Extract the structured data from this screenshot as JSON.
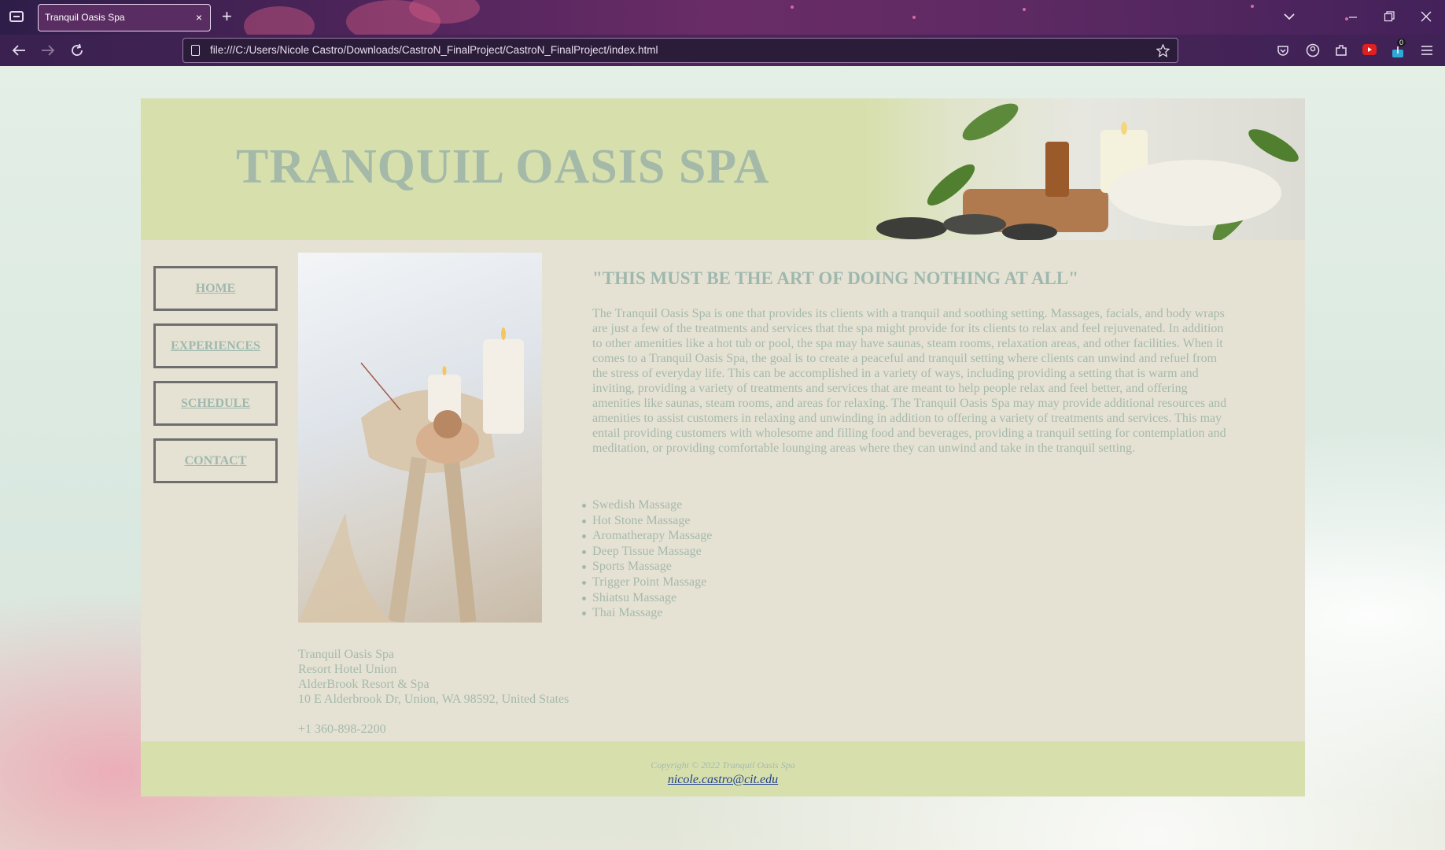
{
  "browser": {
    "tab_title": "Tranquil Oasis Spa",
    "tab_close": "×",
    "new_tab": "+",
    "url": "file:///C:/Users/Nicole Castro/Downloads/CastroN_FinalProject/CastroN_FinalProject/index.html",
    "downloads_badge": "0",
    "icons": {
      "tab_list": "tab-list-icon",
      "back": "back-arrow-icon",
      "forward": "forward-arrow-icon",
      "reload": "reload-icon",
      "bookmark": "star-icon",
      "pocket": "pocket-icon",
      "account": "account-icon",
      "extensions": "extensions-icon",
      "youtube": "youtube-icon",
      "download": "download-icon",
      "menu": "hamburger-menu-icon"
    }
  },
  "site": {
    "title": "TRANQUIL OASIS SPA",
    "nav": [
      "HOME",
      "EXPERIENCES",
      "SCHEDULE",
      "CONTACT"
    ],
    "quote": "\"THIS MUST BE THE ART OF DOING NOTHING AT ALL\"",
    "paragraph": "The Tranquil Oasis Spa is one that provides its clients with a tranquil and soothing setting. Massages, facials, and body wraps are just a few of the treatments and services that the spa might provide for its clients to relax and feel rejuvenated. In addition to other amenities like a hot tub or pool, the spa may have saunas, steam rooms, relaxation areas, and other facilities. When it comes to a Tranquil Oasis Spa, the goal is to create a peaceful and tranquil setting where clients can unwind and refuel from the stress of everyday life. This can be accomplished in a variety of ways, including providing a setting that is warm and inviting, providing a variety of treatments and services that are meant to help people relax and feel better, and offering amenities like saunas, steam rooms, and areas for relaxing. The Tranquil Oasis Spa may may provide additional resources and amenities to assist customers in relaxing and unwinding in addition to offering a variety of treatments and services. This may entail providing customers with wholesome and filling food and beverages, providing a tranquil setting for contemplation and meditation, or providing comfortable lounging areas where they can unwind and take in the tranquil setting.",
    "services": [
      "Swedish Massage",
      "Hot Stone Massage",
      "Aromatherapy Massage",
      "Deep Tissue Massage",
      "Sports Massage",
      "Trigger Point Massage",
      "Shiatsu Massage",
      "Thai Massage"
    ],
    "address": [
      "Tranquil Oasis Spa",
      "Resort Hotel Union",
      "AlderBrook Resort & Spa",
      "10 E Alderbrook Dr, Union, WA 98592, United States"
    ],
    "phone": "+1 360-898-2200",
    "copyright": "Copyright © 2022 Tranquil Oasis Spa",
    "email": "nicole.castro@cit.edu"
  }
}
